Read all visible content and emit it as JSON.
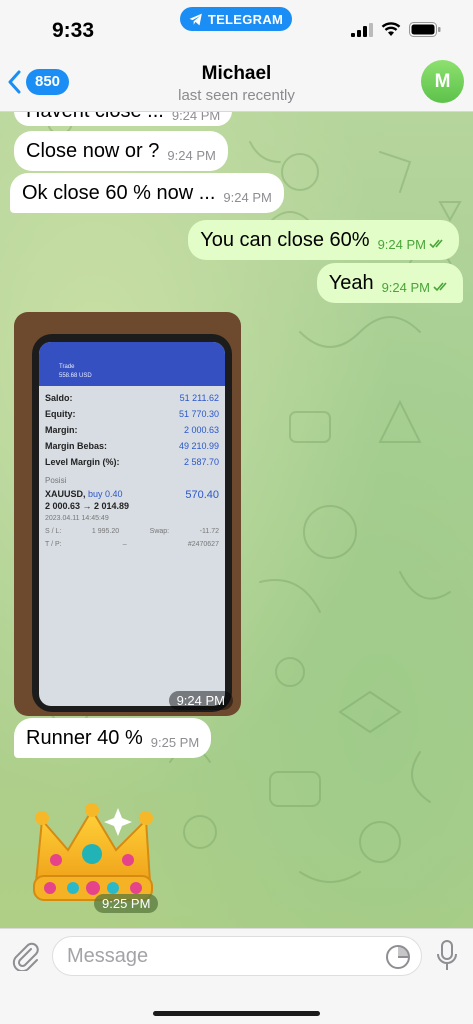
{
  "status_bar": {
    "time": "9:33",
    "pill_label": "TELEGRAM",
    "pill_color": "#1a8ef5"
  },
  "header": {
    "back_count": "850",
    "contact_name": "Michael",
    "contact_status": "last seen recently",
    "avatar_initial": "M",
    "avatar_color": "#6dd154"
  },
  "messages": [
    {
      "direction": "in",
      "text": "Havent close ...",
      "time": "9:24 PM"
    },
    {
      "direction": "in",
      "text": "Close now or ?",
      "time": "9:24 PM"
    },
    {
      "direction": "in",
      "text": "Ok close 60 % now ...",
      "time": "9:24 PM"
    },
    {
      "direction": "out",
      "text": "You can close 60%",
      "time": "9:24 PM",
      "read": true
    },
    {
      "direction": "out",
      "text": "Yeah",
      "time": "9:24 PM",
      "read": true
    },
    {
      "direction": "in",
      "type": "photo",
      "time": "9:24 PM"
    },
    {
      "direction": "in",
      "text": "Runner 40 %",
      "time": "9:25 PM"
    },
    {
      "direction": "in",
      "type": "sticker",
      "sticker_icon": "crown-sticker",
      "time": "9:25 PM"
    }
  ],
  "photo_content": {
    "top_title": "Trade",
    "top_sub": "558.68 USD",
    "rows": [
      {
        "k": "Saldo:",
        "v": "51 211.62"
      },
      {
        "k": "Equity:",
        "v": "51 770.30"
      },
      {
        "k": "Margin:",
        "v": "2 000.63"
      },
      {
        "k": "Margin Bebas:",
        "v": "49 210.99"
      },
      {
        "k": "Level Margin (%):",
        "v": "2 587.70"
      }
    ],
    "section": "Posisi",
    "symbol": "XAUUSD,",
    "side": "buy 0.40",
    "profit": "570.40",
    "price_move": "2 000.63 → 2 014.89",
    "date": "2023.04.11 14:45:49",
    "sl_label": "S / L:",
    "sl_value": "1 995.20",
    "swap_label": "Swap:",
    "swap_value": "-11.72",
    "tp_label": "T / P:",
    "tp_value": "–",
    "ticket": "#2470627"
  },
  "input": {
    "placeholder": "Message"
  },
  "colors": {
    "accent": "#1a8ef5",
    "outgoing_bubble": "#e2fdc8",
    "incoming_bubble": "#ffffff",
    "read_check": "#4aa43a"
  }
}
